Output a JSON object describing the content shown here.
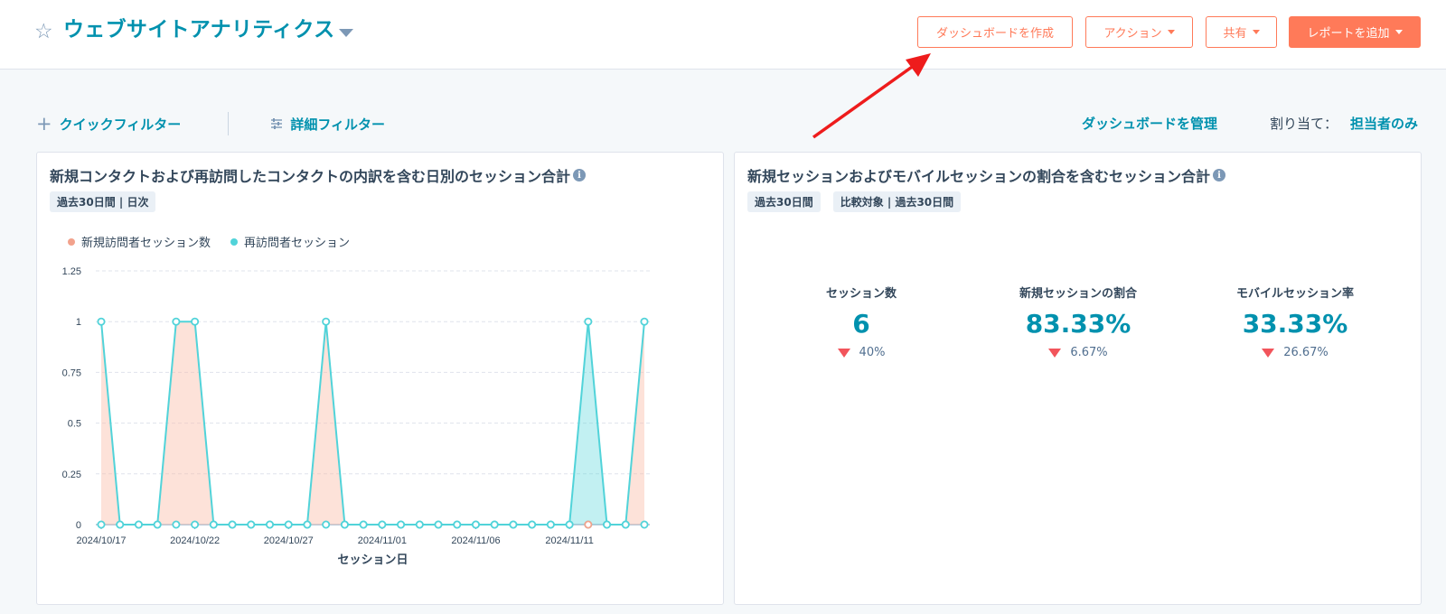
{
  "header": {
    "title": "ウェブサイトアナリティクス",
    "buttons": {
      "create_dashboard": "ダッシュボードを作成",
      "actions": "アクション",
      "share": "共有",
      "add_report": "レポートを追加"
    }
  },
  "filters": {
    "quick_filter": "クイックフィルター",
    "advanced_filter": "詳細フィルター",
    "manage_dashboards": "ダッシュボードを管理",
    "assign_label": "割り当て：",
    "assign_value": "担当者のみ"
  },
  "report1": {
    "title": "新規コンタクトおよび再訪問したコンタクトの内訳を含む日別のセッション合計",
    "tag": "過去30日間 | 日次",
    "legend": [
      "新規訪問者セッション数",
      "再訪問者セッション"
    ]
  },
  "report2": {
    "title": "新規セッションおよびモバイルセッションの割合を含むセッション合計",
    "tags": [
      "過去30日間",
      "比較対象 | 過去30日間"
    ],
    "kpis": [
      {
        "label": "セッション数",
        "value": "6",
        "change": "40%",
        "direction": "down"
      },
      {
        "label": "新規セッションの割合",
        "value": "83.33%",
        "change": "6.67%",
        "direction": "down"
      },
      {
        "label": "モバイルセッション率",
        "value": "33.33%",
        "change": "26.67%",
        "direction": "down"
      }
    ]
  },
  "colors": {
    "accent": "#0091ae",
    "brand_orange": "#ff7a59",
    "new_sessions": "#f2a28c",
    "returning_sessions": "#51d3d9",
    "negative": "#f2545b"
  },
  "chart_data": {
    "type": "area",
    "title": "",
    "xlabel": "セッション日",
    "ylabel": "",
    "ylim": [
      0,
      1.25
    ],
    "yticks": [
      "0",
      "0.25",
      "0.5",
      "0.75",
      "1",
      "1.25"
    ],
    "xtick_labels": [
      "2024/10/17",
      "2024/10/22",
      "2024/10/27",
      "2024/11/01",
      "2024/11/06",
      "2024/11/11"
    ],
    "x": [
      "2024/10/17",
      "2024/10/18",
      "2024/10/19",
      "2024/10/20",
      "2024/10/21",
      "2024/10/22",
      "2024/10/23",
      "2024/10/24",
      "2024/10/25",
      "2024/10/26",
      "2024/10/27",
      "2024/10/28",
      "2024/10/29",
      "2024/10/30",
      "2024/10/31",
      "2024/11/01",
      "2024/11/02",
      "2024/11/03",
      "2024/11/04",
      "2024/11/05",
      "2024/11/06",
      "2024/11/07",
      "2024/11/08",
      "2024/11/09",
      "2024/11/10",
      "2024/11/11",
      "2024/11/12",
      "2024/11/13",
      "2024/11/14",
      "2024/11/15"
    ],
    "series": [
      {
        "name": "新規訪問者セッション数",
        "values": [
          1,
          0,
          0,
          0,
          1,
          1,
          0,
          0,
          0,
          0,
          0,
          0,
          1,
          0,
          0,
          0,
          0,
          0,
          0,
          0,
          0,
          0,
          0,
          0,
          0,
          0,
          0,
          0,
          0,
          1
        ]
      },
      {
        "name": "再訪問者セッション",
        "values": [
          0,
          0,
          0,
          0,
          0,
          0,
          0,
          0,
          0,
          0,
          0,
          0,
          0,
          0,
          0,
          0,
          0,
          0,
          0,
          0,
          0,
          0,
          0,
          0,
          0,
          0,
          1,
          0,
          0,
          0
        ]
      }
    ]
  }
}
